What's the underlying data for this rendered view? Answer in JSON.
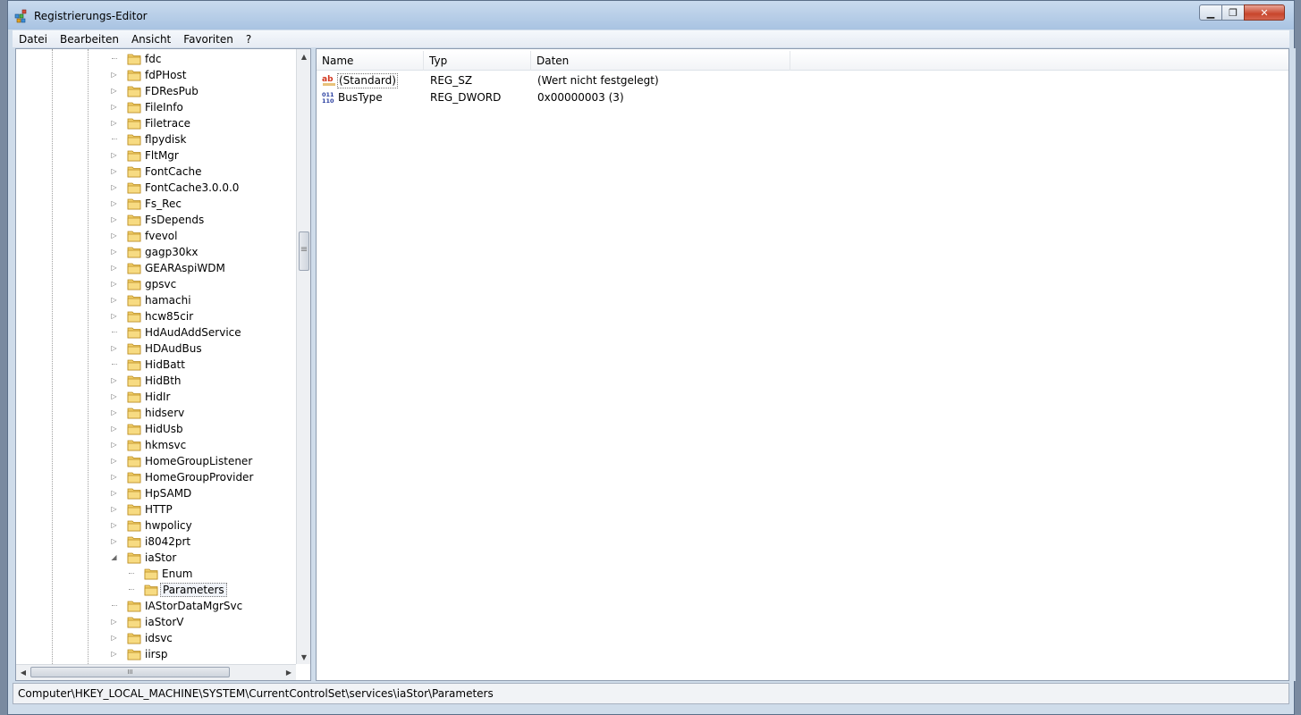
{
  "window": {
    "title": "Registrierungs-Editor",
    "accent": "#b9cfe8"
  },
  "menu": [
    "Datei",
    "Bearbeiten",
    "Ansicht",
    "Favoriten",
    "?"
  ],
  "tree": {
    "items": [
      {
        "label": "fdc",
        "level": 0,
        "expander": "none"
      },
      {
        "label": "fdPHost",
        "level": 0,
        "expander": "collapsed"
      },
      {
        "label": "FDResPub",
        "level": 0,
        "expander": "collapsed"
      },
      {
        "label": "FileInfo",
        "level": 0,
        "expander": "collapsed"
      },
      {
        "label": "Filetrace",
        "level": 0,
        "expander": "collapsed"
      },
      {
        "label": "flpydisk",
        "level": 0,
        "expander": "none"
      },
      {
        "label": "FltMgr",
        "level": 0,
        "expander": "collapsed"
      },
      {
        "label": "FontCache",
        "level": 0,
        "expander": "collapsed"
      },
      {
        "label": "FontCache3.0.0.0",
        "level": 0,
        "expander": "collapsed"
      },
      {
        "label": "Fs_Rec",
        "level": 0,
        "expander": "collapsed"
      },
      {
        "label": "FsDepends",
        "level": 0,
        "expander": "collapsed"
      },
      {
        "label": "fvevol",
        "level": 0,
        "expander": "collapsed"
      },
      {
        "label": "gagp30kx",
        "level": 0,
        "expander": "collapsed"
      },
      {
        "label": "GEARAspiWDM",
        "level": 0,
        "expander": "collapsed"
      },
      {
        "label": "gpsvc",
        "level": 0,
        "expander": "collapsed"
      },
      {
        "label": "hamachi",
        "level": 0,
        "expander": "collapsed"
      },
      {
        "label": "hcw85cir",
        "level": 0,
        "expander": "collapsed"
      },
      {
        "label": "HdAudAddService",
        "level": 0,
        "expander": "none"
      },
      {
        "label": "HDAudBus",
        "level": 0,
        "expander": "collapsed"
      },
      {
        "label": "HidBatt",
        "level": 0,
        "expander": "none"
      },
      {
        "label": "HidBth",
        "level": 0,
        "expander": "collapsed"
      },
      {
        "label": "HidIr",
        "level": 0,
        "expander": "collapsed"
      },
      {
        "label": "hidserv",
        "level": 0,
        "expander": "collapsed"
      },
      {
        "label": "HidUsb",
        "level": 0,
        "expander": "collapsed"
      },
      {
        "label": "hkmsvc",
        "level": 0,
        "expander": "collapsed"
      },
      {
        "label": "HomeGroupListener",
        "level": 0,
        "expander": "collapsed"
      },
      {
        "label": "HomeGroupProvider",
        "level": 0,
        "expander": "collapsed"
      },
      {
        "label": "HpSAMD",
        "level": 0,
        "expander": "collapsed"
      },
      {
        "label": "HTTP",
        "level": 0,
        "expander": "collapsed"
      },
      {
        "label": "hwpolicy",
        "level": 0,
        "expander": "collapsed"
      },
      {
        "label": "i8042prt",
        "level": 0,
        "expander": "collapsed"
      },
      {
        "label": "iaStor",
        "level": 0,
        "expander": "expanded"
      },
      {
        "label": "Enum",
        "level": 1,
        "expander": "none"
      },
      {
        "label": "Parameters",
        "level": 1,
        "expander": "none",
        "selected": true
      },
      {
        "label": "IAStorDataMgrSvc",
        "level": 0,
        "expander": "none"
      },
      {
        "label": "iaStorV",
        "level": 0,
        "expander": "collapsed"
      },
      {
        "label": "idsvc",
        "level": 0,
        "expander": "collapsed"
      },
      {
        "label": "iirsp",
        "level": 0,
        "expander": "collapsed"
      }
    ]
  },
  "list": {
    "columns": [
      "Name",
      "Typ",
      "Daten"
    ],
    "rows": [
      {
        "icon": "string-value-icon",
        "name": "(Standard)",
        "type": "REG_SZ",
        "data": "(Wert nicht festgelegt)",
        "selected": true
      },
      {
        "icon": "dword-value-icon",
        "name": "BusType",
        "type": "REG_DWORD",
        "data": "0x00000003 (3)",
        "selected": false
      }
    ]
  },
  "status": {
    "path": "Computer\\HKEY_LOCAL_MACHINE\\SYSTEM\\CurrentControlSet\\services\\iaStor\\Parameters"
  },
  "scrollbars": {
    "hthumb_glyph": "III",
    "vthumb_glyph": "≡"
  }
}
